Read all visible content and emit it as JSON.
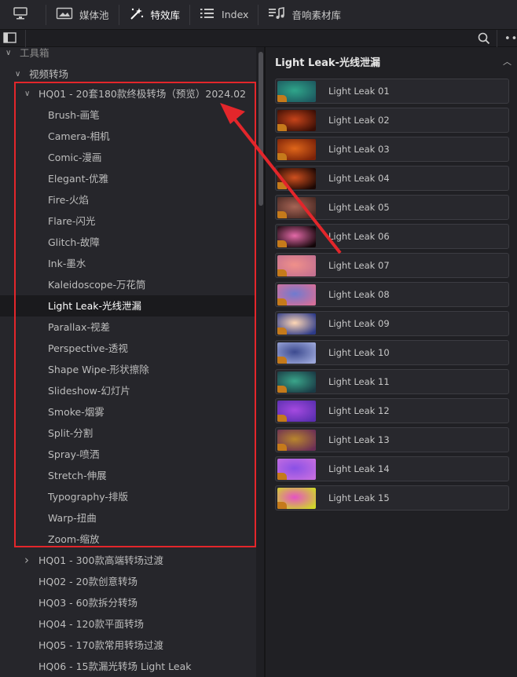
{
  "toolbar": {
    "items": [
      {
        "label": "",
        "icon": "monitor-icon"
      },
      {
        "label": "媒体池",
        "icon": "media-pool-icon"
      },
      {
        "label": "特效库",
        "icon": "magic-wand-icon",
        "active": true
      },
      {
        "label": "Index",
        "icon": "list-icon"
      },
      {
        "label": "音响素材库",
        "icon": "sound-library-icon"
      }
    ]
  },
  "tree": {
    "toolbox": "工具箱",
    "video_transitions": "视频转场",
    "group_open": "HQ01 - 20套180款终极转场（预览）2024.02",
    "children": [
      "Brush-画笔",
      "Camera-相机",
      "Comic-漫画",
      "Elegant-优雅",
      "Fire-火焰",
      "Flare-闪光",
      "Glitch-故障",
      "Ink-墨水",
      "Kaleidoscope-万花筒",
      "Light Leak-光线泄漏",
      "Parallax-视差",
      "Perspective-透视",
      "Shape Wipe-形状擦除",
      "Slideshow-幻灯片",
      "Smoke-烟雾",
      "Split-分割",
      "Spray-喷洒",
      "Stretch-伸展",
      "Typography-排版",
      "Warp-扭曲",
      "Zoom-缩放"
    ],
    "selected_index": 9,
    "more_groups": [
      {
        "label": "HQ01 - 300款高端转场过渡",
        "expandable": true
      },
      {
        "label": "HQ02 - 20款创意转场",
        "expandable": false
      },
      {
        "label": "HQ03 - 60款拆分转场",
        "expandable": false
      },
      {
        "label": "HQ04 - 120款平面转场",
        "expandable": false
      },
      {
        "label": "HQ05 - 170款常用转场过渡",
        "expandable": false
      },
      {
        "label": "HQ06 - 15款漏光转场 Light Leak",
        "expandable": false
      }
    ]
  },
  "panel": {
    "title": "Light Leak-光线泄漏",
    "items": [
      {
        "label": "Light Leak 01",
        "colors": [
          "#2fa58a",
          "#1d5a60"
        ]
      },
      {
        "label": "Light Leak 02",
        "colors": [
          "#c7441a",
          "#3a0e05"
        ]
      },
      {
        "label": "Light Leak 03",
        "colors": [
          "#e0661a",
          "#7a2208"
        ]
      },
      {
        "label": "Light Leak 04",
        "colors": [
          "#d0501f",
          "#1c0703"
        ]
      },
      {
        "label": "Light Leak 05",
        "colors": [
          "#a76455",
          "#4a2a24"
        ]
      },
      {
        "label": "Light Leak 06",
        "colors": [
          "#e46aa8",
          "#120508"
        ]
      },
      {
        "label": "Light Leak 07",
        "colors": [
          "#f0908a",
          "#c57190"
        ]
      },
      {
        "label": "Light Leak 08",
        "colors": [
          "#6f7bd0",
          "#d46f9a"
        ]
      },
      {
        "label": "Light Leak 09",
        "colors": [
          "#ffd7b5",
          "#2c3a88"
        ]
      },
      {
        "label": "Light Leak 10",
        "colors": [
          "#3c4a8f",
          "#9aa5d8"
        ]
      },
      {
        "label": "Light Leak 11",
        "colors": [
          "#3aa58a",
          "#1a3b45"
        ]
      },
      {
        "label": "Light Leak 12",
        "colors": [
          "#a54ae0",
          "#5b2fb0"
        ]
      },
      {
        "label": "Light Leak 13",
        "colors": [
          "#b9862d",
          "#6b2e55"
        ]
      },
      {
        "label": "Light Leak 14",
        "colors": [
          "#8a50e6",
          "#c46de0"
        ]
      },
      {
        "label": "Light Leak 15",
        "colors": [
          "#e552c5",
          "#d0d62a"
        ]
      }
    ]
  },
  "colors": {
    "annotation": "#e3262b"
  }
}
